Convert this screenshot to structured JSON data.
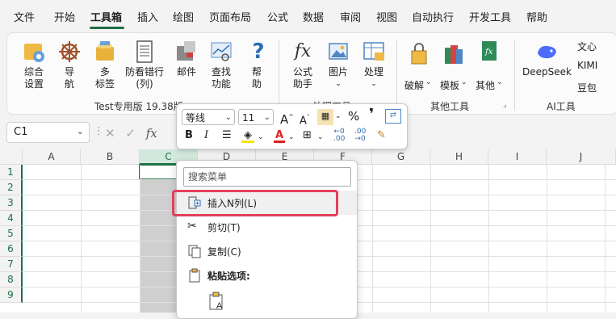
{
  "menu": {
    "tabs": [
      "文件",
      "开始",
      "工具箱",
      "插入",
      "绘图",
      "页面布局",
      "公式",
      "数据",
      "审阅",
      "视图",
      "自动执行",
      "开发工具",
      "帮助"
    ],
    "active_tab": "工具箱"
  },
  "ribbon": {
    "buttons": {
      "settings": "综合\n设置",
      "navigate": "导\n航",
      "tabs": "多\n标签",
      "crosshair": "防看错行\n(列)",
      "mail": "邮件",
      "find": "查找\n功能",
      "help": "帮\n助",
      "formula_helper": "公式\n助手",
      "picture": "图片",
      "process": "处理",
      "crack": "破解",
      "template": "模板",
      "other": "其他",
      "wenxin": "文心",
      "kimi": "KIMI",
      "doubao": "豆包",
      "deepseek": "DeepSeek"
    },
    "groups": {
      "test": "Test专用版 19.38版",
      "process": "处理工具",
      "other": "其他工具",
      "ai": "AI工具"
    }
  },
  "formula_bar": {
    "name_box": "C1",
    "fx": "fx"
  },
  "grid": {
    "columns": [
      "A",
      "B",
      "C",
      "D",
      "E",
      "F",
      "G",
      "H",
      "I",
      "J"
    ],
    "rows": [
      "1",
      "2",
      "3",
      "4",
      "5",
      "6",
      "7",
      "8",
      "9"
    ],
    "selected_column": "C"
  },
  "mini_toolbar": {
    "font": "等线",
    "size": "11",
    "bold": "B",
    "italic": "I",
    "percent": "%",
    "comma": "❜",
    "grow": "A",
    "shrink": "A"
  },
  "context_menu": {
    "search_placeholder": "搜索菜单",
    "items": [
      "插入N列(L)",
      "剪切(T)",
      "复制(C)",
      "粘贴选项:"
    ]
  },
  "colors": {
    "accent": "#1e7145",
    "highlight": "#e0405a"
  }
}
